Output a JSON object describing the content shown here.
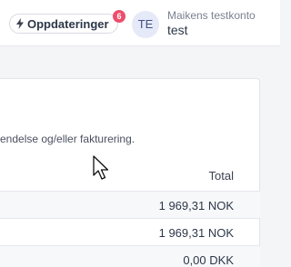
{
  "header": {
    "update_button_label": "Oppdateringer",
    "update_badge_count": "6",
    "avatar_initials": "TE",
    "account_name": "Maikens testkonto",
    "account_user": "test"
  },
  "card": {
    "description": "endelse og/eller fakturering.",
    "column_total": "Total",
    "rows": [
      {
        "total": "1 969,31 NOK"
      },
      {
        "total": "1 969,31 NOK"
      },
      {
        "total": "0,00 DKK"
      }
    ]
  },
  "colors": {
    "badge": "#ec4f6b",
    "avatar_bg": "#e6e9f7"
  }
}
